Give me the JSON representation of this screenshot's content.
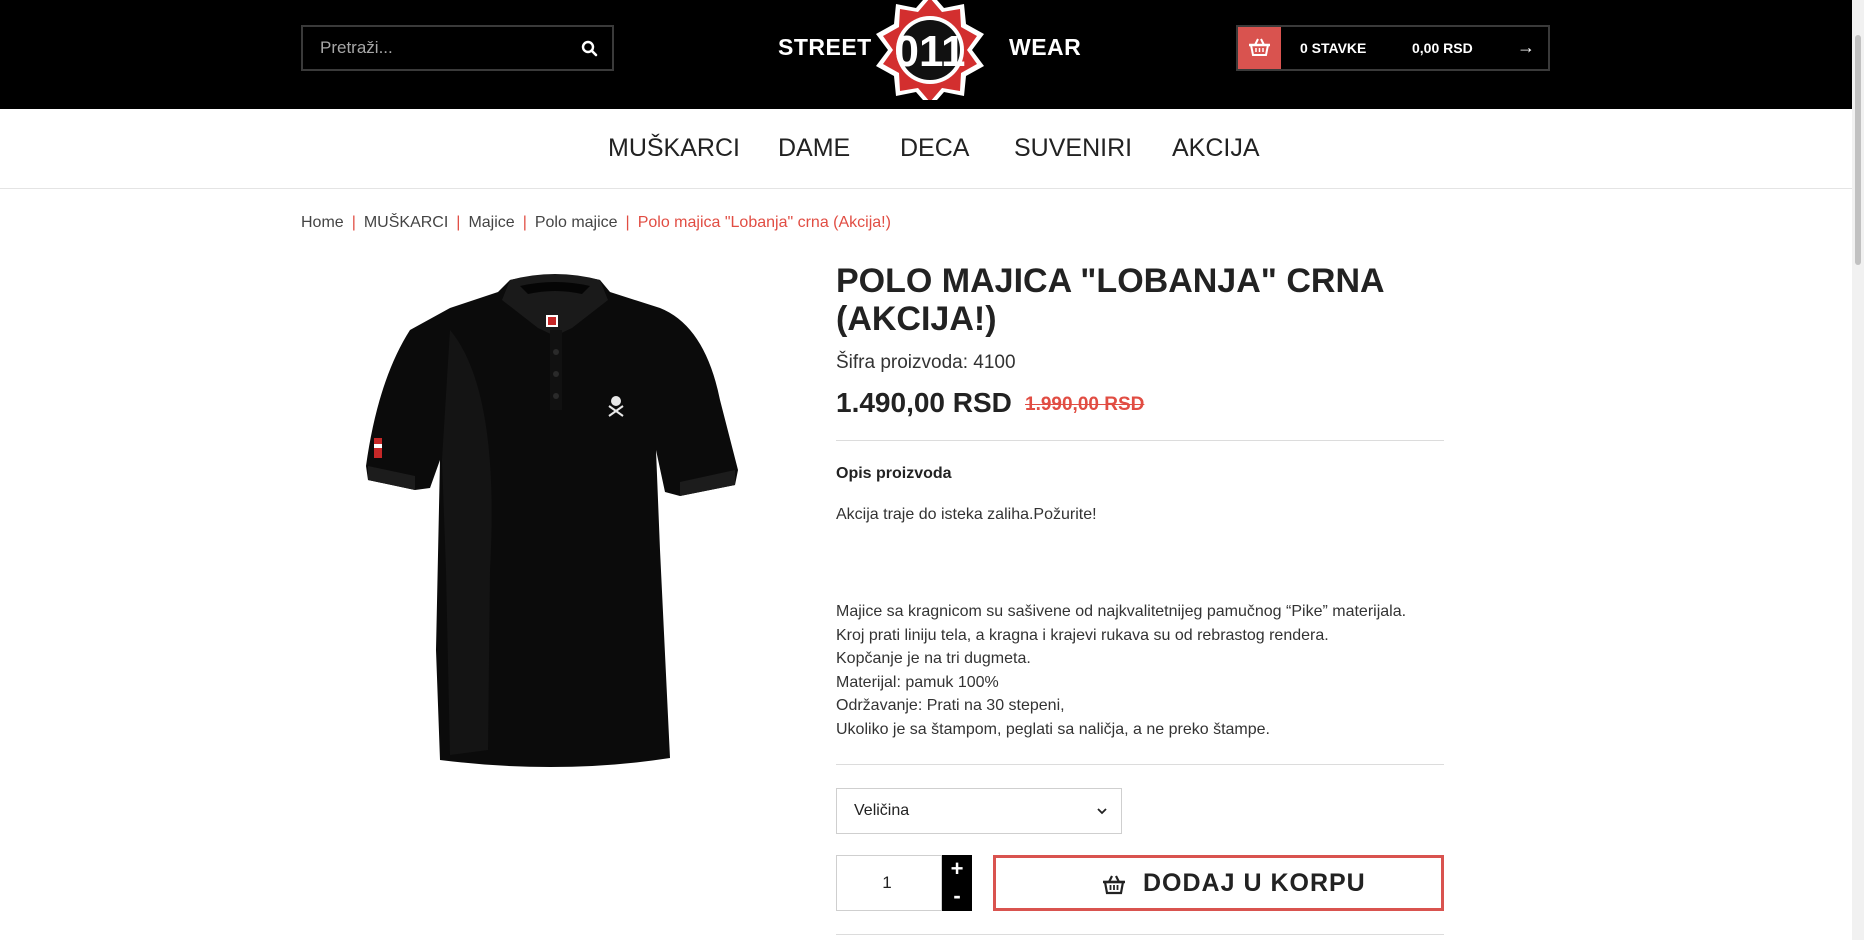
{
  "header": {
    "search": {
      "placeholder": "Pretraži...",
      "value": ""
    },
    "brand_left": "STREET",
    "brand_right": "WEAR",
    "logo_text": "011",
    "cart": {
      "items_label": "0 STAVKE",
      "total_label": "0,00 RSD",
      "arrow": "→"
    }
  },
  "nav": {
    "items": [
      "MUŠKARCI",
      "DAME",
      "DECA",
      "SUVENIRI",
      "AKCIJA"
    ]
  },
  "breadcrumb": {
    "items": [
      "Home",
      "MUŠKARCI",
      "Majice",
      "Polo majice"
    ],
    "current": "Polo majica \"Lobanja\" crna (Akcija!)",
    "separator": "|"
  },
  "product": {
    "title": "POLO MAJICA \"LOBANJA\" CRNA (AKCIJA!)",
    "sku_label": "Šifra proizvoda: 4100",
    "price_new": "1.490,00 RSD",
    "price_old": "1.990,00 RSD",
    "description_title": "Opis proizvoda",
    "description_promo": "Akcija traje do isteka zaliha.Požurite!",
    "description_lines": [
      "Majice sa kragnicom su sašivene od najkvalitetnijeg pamučnog “Pike” materijala.",
      "Kroj prati liniju tela, a kragna i krajevi rukava su od rebrastog rendera.",
      "Kopčanje je na tri dugmeta.",
      "Materijal: pamuk 100%",
      "Održavanje: Prati na 30 stepeni,",
      "Ukoliko je sa štampom, peglati sa naličja, a ne preko štampe."
    ],
    "size_label": "Veličina",
    "quantity": "1",
    "plus": "+",
    "minus": "-",
    "add_to_cart": "DODAJ U KORPU"
  },
  "colors": {
    "accent": "#d9534f",
    "header_bg": "#000000",
    "sale_red": "#e14d43"
  }
}
